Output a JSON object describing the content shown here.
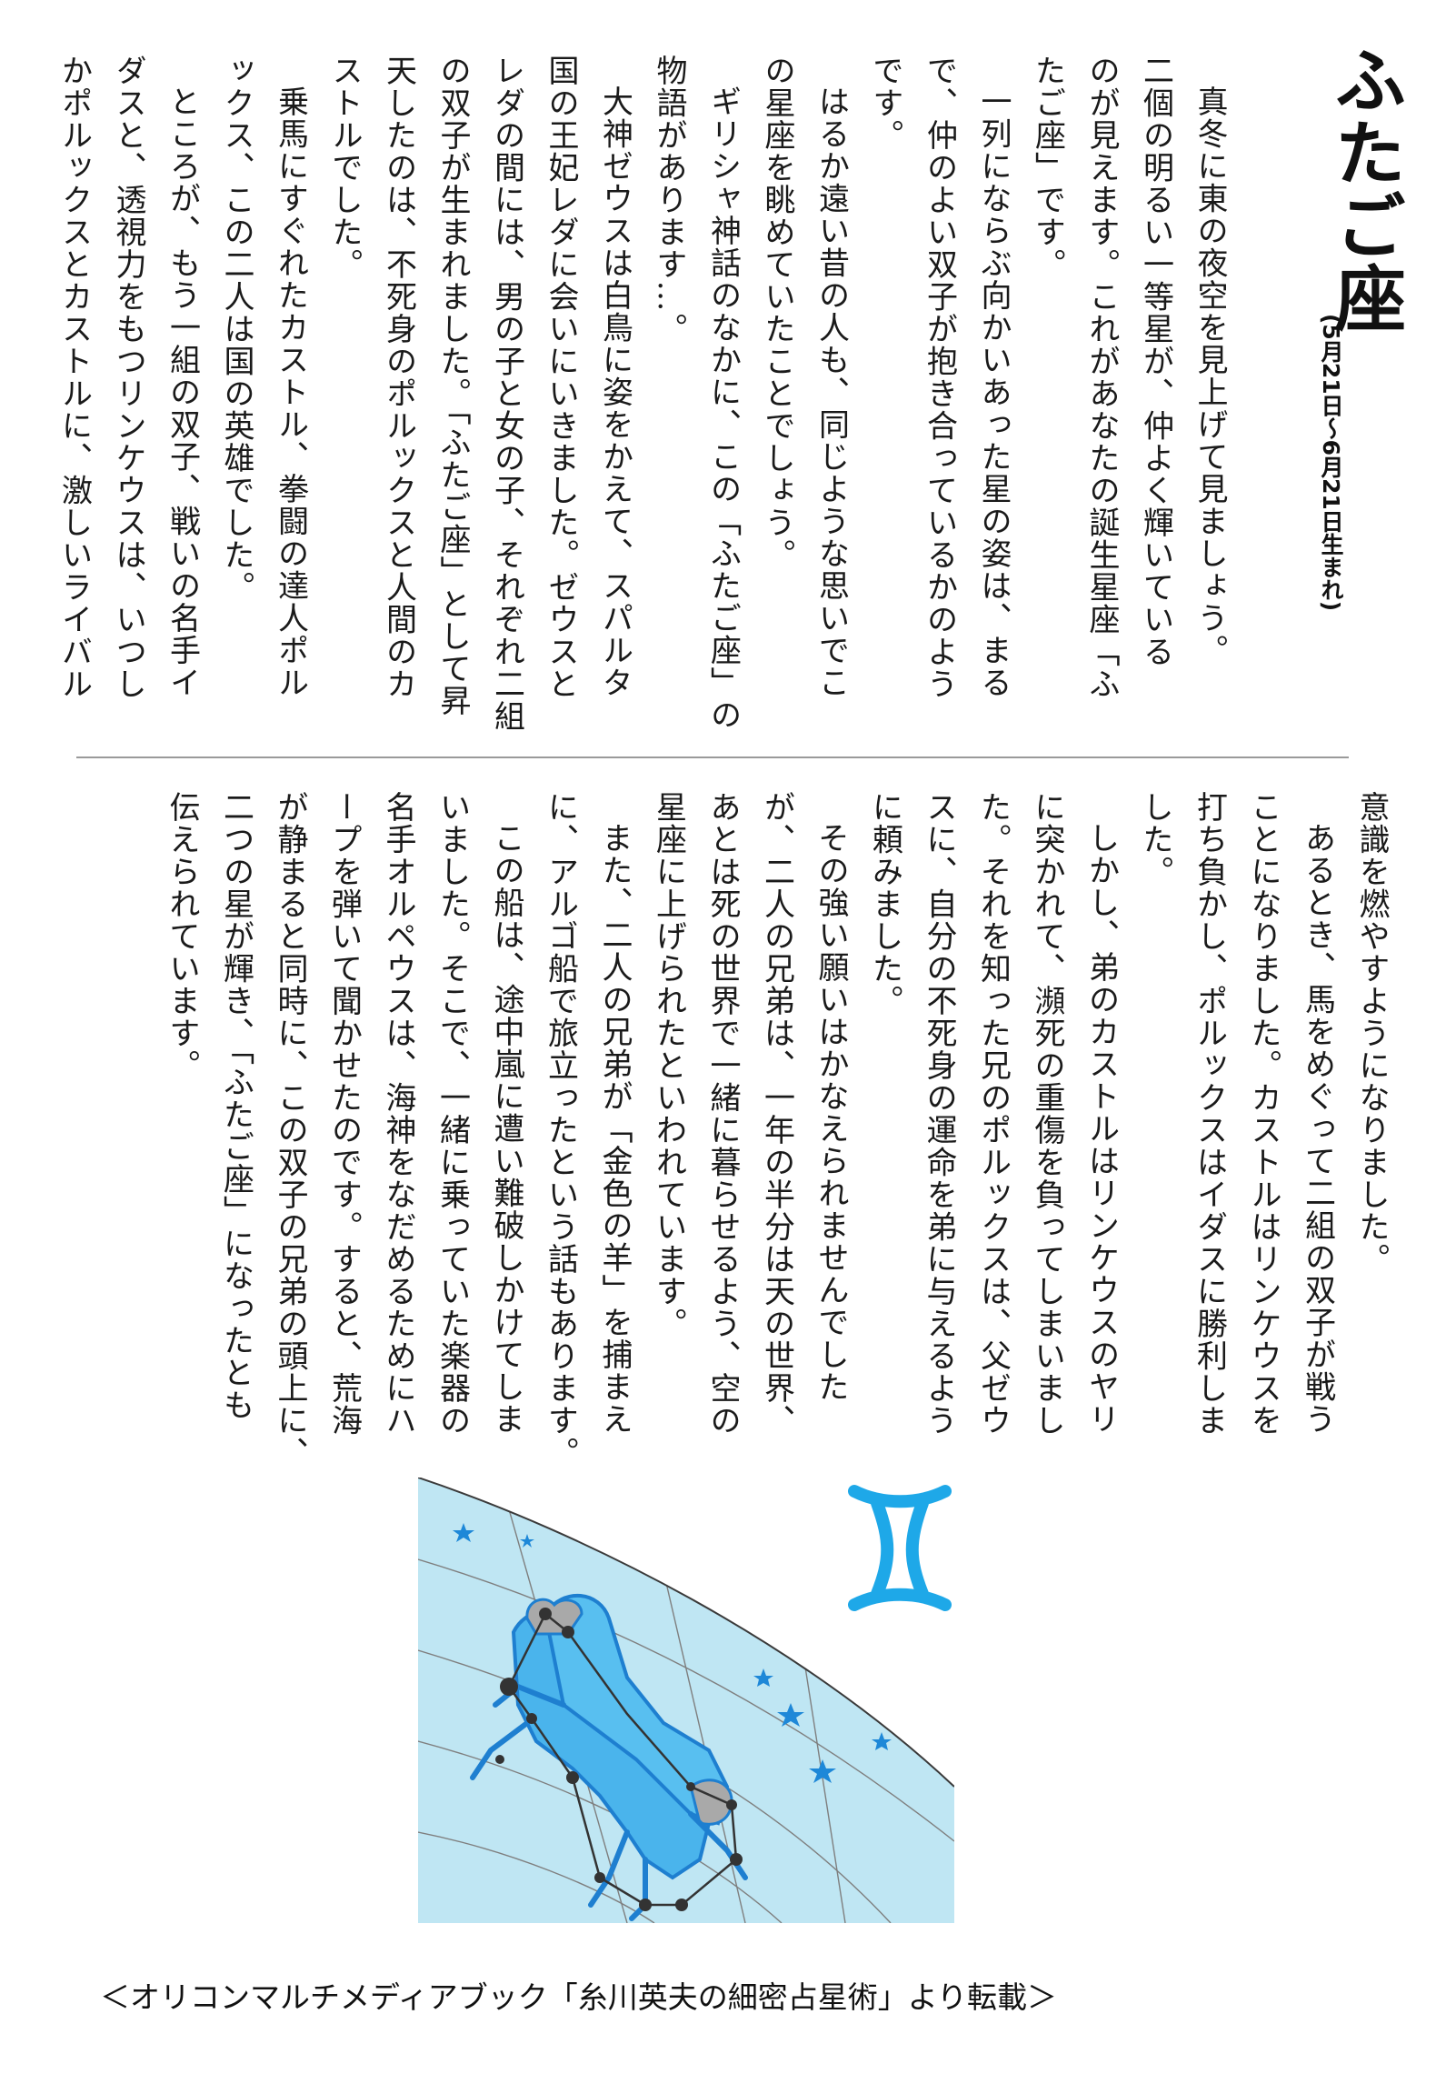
{
  "title": "ふたご座",
  "subtitle": "(5月21日～6月21日生まれ)",
  "top_lines": [
    {
      "text": "真冬に東の夜空を見上げて見ましょう。",
      "indent": true
    },
    {
      "text": "二個の明るい一等星が、仲よく輝いている",
      "indent": false
    },
    {
      "text": "のが見えます。これがあなたの誕生星座「ふ",
      "indent": false
    },
    {
      "text": "たご座」です。",
      "indent": false
    },
    {
      "text": "一列にならぶ向かいあった星の姿は、まる",
      "indent": true
    },
    {
      "text": "で、仲のよい双子が抱き合っているかのよう",
      "indent": false
    },
    {
      "text": "です。",
      "indent": false
    },
    {
      "text": "はるか遠い昔の人も、同じような思いでこ",
      "indent": true
    },
    {
      "text": "の星座を眺めていたことでしょう。",
      "indent": false
    },
    {
      "text": "ギリシャ神話のなかに、この「ふたご座」の",
      "indent": true
    },
    {
      "text": "物語があります…。",
      "indent": false
    },
    {
      "text": "大神ゼウスは白鳥に姿をかえて、スパルタ",
      "indent": true
    },
    {
      "text": "国の王妃レダに会いにいきました。ゼウスと",
      "indent": false
    },
    {
      "text": "レダの間には、男の子と女の子、それぞれ二組",
      "indent": false
    },
    {
      "text": "の双子が生まれました。「ふたご座」として昇",
      "indent": false
    },
    {
      "text": "天したのは、不死身のポルックスと人間のカ",
      "indent": false
    },
    {
      "text": "ストルでした。",
      "indent": false
    },
    {
      "text": "乗馬にすぐれたカストル、拳闘の達人ポル",
      "indent": true
    },
    {
      "text": "ックス、この二人は国の英雄でした。",
      "indent": false
    },
    {
      "text": "ところが、もう一組の双子、戦いの名手イ",
      "indent": true
    },
    {
      "text": "ダスと、透視力をもつリンケウスは、いつし",
      "indent": false
    },
    {
      "text": "かポルックスとカストルに、激しいライバル",
      "indent": false
    }
  ],
  "bottom_lines": [
    {
      "text": "意識を燃やすようになりました。",
      "indent": false
    },
    {
      "text": "あるとき、馬をめぐって二組の双子が戦う",
      "indent": true
    },
    {
      "text": "ことになりました。カストルはリンケウスを",
      "indent": false
    },
    {
      "text": "打ち負かし、ポルックスはイダスに勝利しま",
      "indent": false
    },
    {
      "text": "した。",
      "indent": false
    },
    {
      "text": "しかし、弟のカストルはリンケウスのヤリ",
      "indent": true
    },
    {
      "text": "に突かれて、瀕死の重傷を負ってしまいまし",
      "indent": false
    },
    {
      "text": "た。それを知った兄のポルックスは、父ゼウ",
      "indent": false
    },
    {
      "text": "スに、自分の不死身の運命を弟に与えるよう",
      "indent": false
    },
    {
      "text": "に頼みました。",
      "indent": false
    },
    {
      "text": "その強い願いはかなえられませんでした",
      "indent": true
    },
    {
      "text": "が、二人の兄弟は、一年の半分は天の世界、",
      "indent": false
    },
    {
      "text": "あとは死の世界で一緒に暮らせるよう、空の",
      "indent": false
    },
    {
      "text": "星座に上げられたといわれています。",
      "indent": false
    },
    {
      "text": "また、二人の兄弟が「金色の羊」を捕まえ",
      "indent": true
    },
    {
      "text": "に、アルゴ船で旅立ったという話もあります。",
      "indent": false
    },
    {
      "text": "この船は、途中嵐に遭い難破しかけてしま",
      "indent": true
    },
    {
      "text": "いました。そこで、一緒に乗っていた楽器の",
      "indent": false
    },
    {
      "text": "名手オルペウスは、海神をなだめるためにハ",
      "indent": false
    },
    {
      "text": "ープを弾いて聞かせたのです。すると、荒海",
      "indent": false
    },
    {
      "text": "が静まると同時に、この双子の兄弟の頭上に、",
      "indent": false
    },
    {
      "text": "二つの星が輝き、「ふたご座」になったとも",
      "indent": false
    },
    {
      "text": "伝えられています。",
      "indent": false
    }
  ],
  "caption": "＜オリコンマルチメディアブック「糸川英夫の細密占星術」より転載＞",
  "illustration": {
    "sky_color": "#bfe6f3",
    "figure_color": "#2b9fe0",
    "symbol_color": "#1ea8e8",
    "icon": "gemini-constellation-icon"
  }
}
